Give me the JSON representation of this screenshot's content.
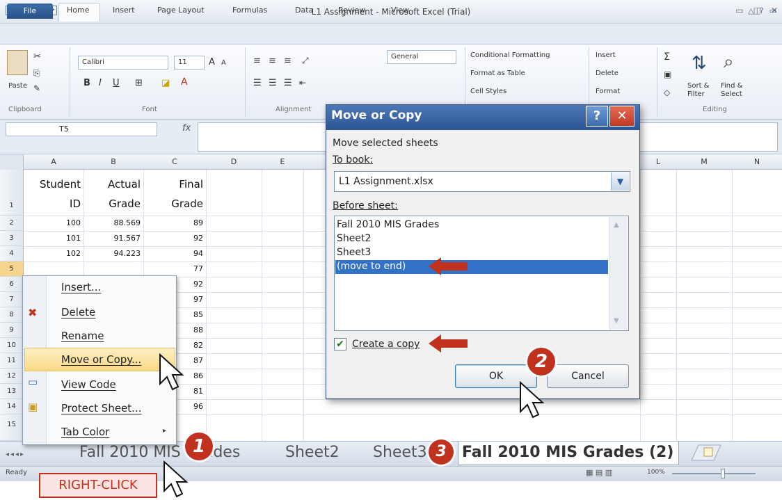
{
  "window": {
    "title": "L1 Assignment - Microsoft Excel (Trial)",
    "qat_icons": [
      "excel-icon",
      "save-icon",
      "undo-icon",
      "redo-icon",
      "customize-icon"
    ]
  },
  "ribbon": {
    "tabs": [
      "File",
      "Home",
      "Insert",
      "Page Layout",
      "Formulas",
      "Data",
      "Review",
      "View"
    ],
    "clipboard": {
      "paste_label": "Paste",
      "group_label": "Clipboard"
    },
    "font": {
      "name": "Calibri",
      "size": "11",
      "group_label": "Font",
      "grow": "A",
      "shrink": "A",
      "bold": "B",
      "italic": "I",
      "underline": "U"
    },
    "alignment": {
      "group_label": "Alignment"
    },
    "number": {
      "format": "General",
      "currency": "$",
      "percent": "%"
    },
    "styles": {
      "conditional": "Conditional Formatting",
      "format_table": "Format as Table",
      "cell_styles": "Cell Styles"
    },
    "cells": {
      "insert": "Insert",
      "delete": "Delete",
      "format": "Format"
    },
    "editing": {
      "sigma": "Σ",
      "sort_filter_1": "Sort &",
      "sort_filter_2": "Filter",
      "find_1": "Find &",
      "find_2": "Select",
      "group_label": "Editing"
    }
  },
  "formula_bar": {
    "name_box": "T5",
    "fx": "fx"
  },
  "grid": {
    "columns": [
      "A",
      "B",
      "C",
      "D",
      "E",
      "L",
      "M",
      "N"
    ],
    "header_row": {
      "a_line1": "Student",
      "a_line2": "ID",
      "b_line1": "Actual",
      "b_line2": "Grade",
      "c_line1": "Final",
      "c_line2": "Grade"
    },
    "row_numbers": [
      "1",
      "2",
      "3",
      "4",
      "5",
      "6",
      "7",
      "8",
      "9",
      "10",
      "11",
      "12",
      "13",
      "14",
      "15"
    ],
    "rows": [
      {
        "a": "100",
        "b": "88.569",
        "c": "89"
      },
      {
        "a": "101",
        "b": "91.567",
        "c": "92"
      },
      {
        "a": "102",
        "b": "94.223",
        "c": "94"
      }
    ],
    "c_values_hidden_rows": [
      "77",
      "92",
      "97",
      "85",
      "88",
      "82",
      "87",
      "86",
      "81",
      "96"
    ]
  },
  "sheet_tabs": {
    "tab1": "Fall 2010 MIS Grades",
    "tab2": "Sheet2",
    "tab3": "Sheet3",
    "active": "Fall 2010 MIS Grades (2)"
  },
  "status": {
    "ready": "Ready",
    "zoom": "100%"
  },
  "context_menu": {
    "items": [
      "Insert...",
      "Delete",
      "Rename",
      "Move or Copy...",
      "View Code",
      "Protect Sheet...",
      "Tab Color"
    ]
  },
  "dialog": {
    "title": "Move or Copy",
    "help": "?",
    "close": "✕",
    "move_selected": "Move selected sheets",
    "to_book_label": "To book:",
    "to_book_value": "L1 Assignment.xlsx",
    "before_sheet_label": "Before sheet:",
    "sheets": [
      "Fall 2010 MIS Grades",
      "Sheet2",
      "Sheet3",
      "(move to end)"
    ],
    "selected_index": 3,
    "create_copy_label": "Create a copy",
    "create_copy_checked": true,
    "ok": "OK",
    "cancel": "Cancel"
  },
  "annotations": {
    "step1": "1",
    "step2": "2",
    "step3": "3",
    "right_click": "RIGHT-CLICK",
    "accent": "#c0321e"
  }
}
